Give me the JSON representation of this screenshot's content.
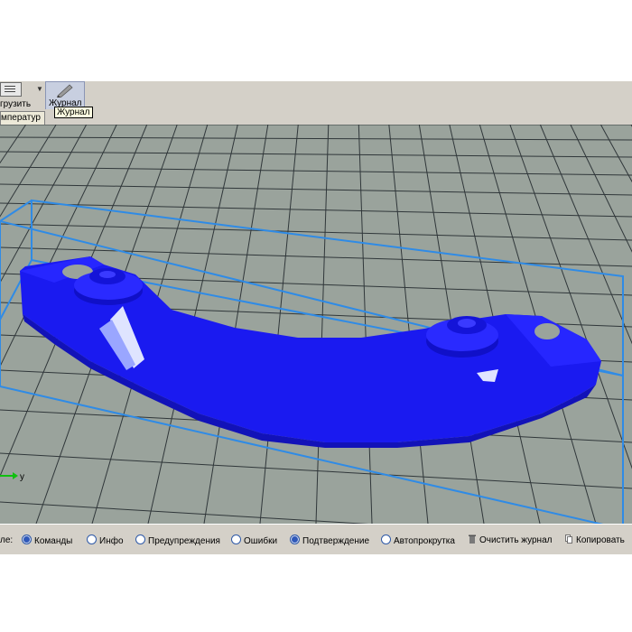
{
  "toolbar": {
    "load_label": "грузить",
    "journal_label": "Журнал",
    "tooltip": "Журнал"
  },
  "tabs": [
    {
      "label": "мператур"
    }
  ],
  "viewport": {
    "model_color": "#1a1af0",
    "bbox_color": "#2f8be6",
    "grid_bg": "#9aa39c",
    "grid_line": "#30373a",
    "axis_label": "y"
  },
  "statusbar": {
    "prefix": "ле:",
    "filters": [
      {
        "label": "Команды",
        "selected": true
      },
      {
        "label": "Инфо",
        "selected": false
      },
      {
        "label": "Предупреждения",
        "selected": false
      },
      {
        "label": "Ошибки",
        "selected": false
      },
      {
        "label": "Подтверждение",
        "selected": true
      },
      {
        "label": "Автопрокрутка",
        "selected": false
      }
    ],
    "clear_log": "Очистить журнал",
    "copy": "Копировать"
  }
}
